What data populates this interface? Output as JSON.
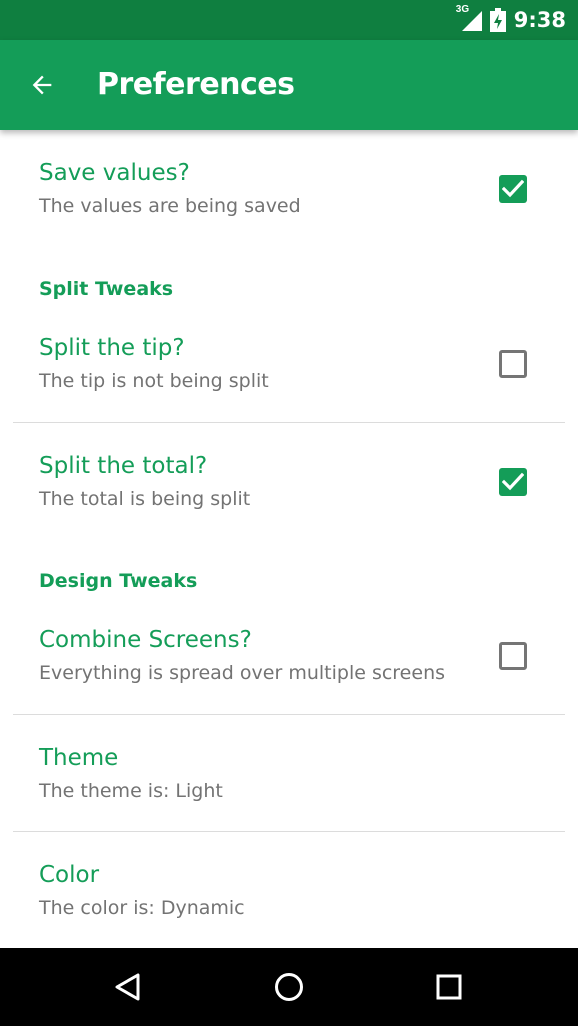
{
  "status_bar": {
    "network_label": "3G",
    "time": "9:38",
    "icons": [
      "signal-icon",
      "battery-charging-icon"
    ]
  },
  "app_bar": {
    "title": "Preferences",
    "back_icon": "arrow-back-icon",
    "color": "#149d58"
  },
  "preferences": {
    "save_values": {
      "title": "Save values?",
      "summary": "The values are being saved",
      "checked": true
    },
    "split_category": "Split Tweaks",
    "split_tip": {
      "title": "Split the tip?",
      "summary": "The tip is not being split",
      "checked": false
    },
    "split_total": {
      "title": "Split the total?",
      "summary": "The total is being split",
      "checked": true
    },
    "design_category": "Design Tweaks",
    "combine_screens": {
      "title": "Combine Screens?",
      "summary": "Everything is spread over multiple screens",
      "checked": false
    },
    "theme": {
      "title": "Theme",
      "summary": "The theme is: Light"
    },
    "color": {
      "title": "Color",
      "summary": "The color is: Dynamic"
    }
  },
  "nav_bar": {
    "icons": [
      "back-triangle-icon",
      "home-circle-icon",
      "recents-square-icon"
    ]
  },
  "colors": {
    "status_bar": "#0f7f40",
    "accent": "#149d58",
    "summary_text": "#737373"
  }
}
